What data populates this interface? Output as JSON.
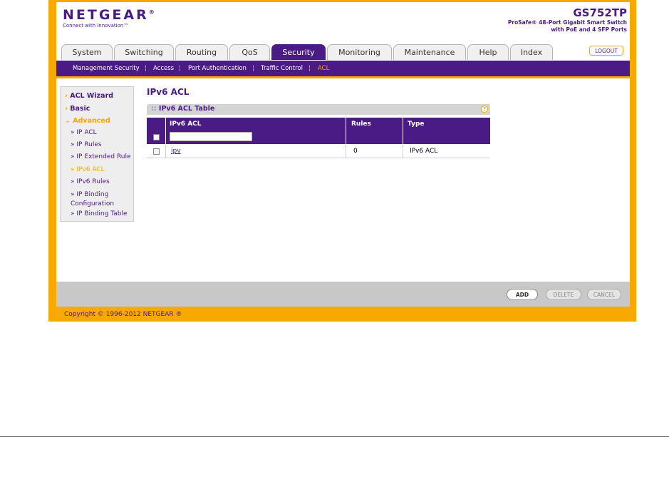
{
  "header": {
    "logo": "NETGEAR",
    "logo_mark": "®",
    "tagline": "Connect with Innovation™",
    "model": "GS752TP",
    "model_desc_line1": "ProSafe® 48-Port Gigabit Smart Switch",
    "model_desc_line2": "with PoE and 4 SFP Ports"
  },
  "tabs": [
    {
      "label": "System"
    },
    {
      "label": "Switching"
    },
    {
      "label": "Routing"
    },
    {
      "label": "QoS"
    },
    {
      "label": "Security",
      "active": true
    },
    {
      "label": "Monitoring"
    },
    {
      "label": "Maintenance"
    },
    {
      "label": "Help"
    },
    {
      "label": "Index"
    }
  ],
  "logout_label": "LOGOUT",
  "subnav": {
    "items": [
      "Management Security",
      "Access",
      "Port Authentication",
      "Traffic Control",
      "ACL"
    ],
    "separator": "¦",
    "active": "ACL"
  },
  "sidebar": {
    "acl_wizard": "ACL Wizard",
    "basic": "Basic",
    "advanced": "Advanced",
    "chev_closed": "›",
    "chev_open": "⌄",
    "bullet": "»",
    "sub_items": [
      "IP ACL",
      "IP Rules",
      "IP Extended Rule",
      "IPv6 ACL",
      "IPv6 Rules",
      "IP Binding Configuration",
      "IP Binding Table"
    ],
    "active_sub": "IPv6 ACL"
  },
  "page_title": "IPv6 ACL",
  "table": {
    "title": "IPv6 ACL Table",
    "title_prefix": "::",
    "help_symbol": "?",
    "columns": [
      "IPv6 ACL",
      "Rules",
      "Type"
    ],
    "input_value": "",
    "rows": [
      {
        "name": "ipv",
        "rules": "0",
        "type": "IPv6 ACL"
      }
    ]
  },
  "buttons": {
    "add": "ADD",
    "delete": "DELETE",
    "cancel": "CANCEL"
  },
  "footer": {
    "copyright": "Copyright © 1996-2012 NETGEAR ®"
  },
  "colors": {
    "brand_purple": "#4a1a85",
    "accent_orange": "#f8a800"
  }
}
